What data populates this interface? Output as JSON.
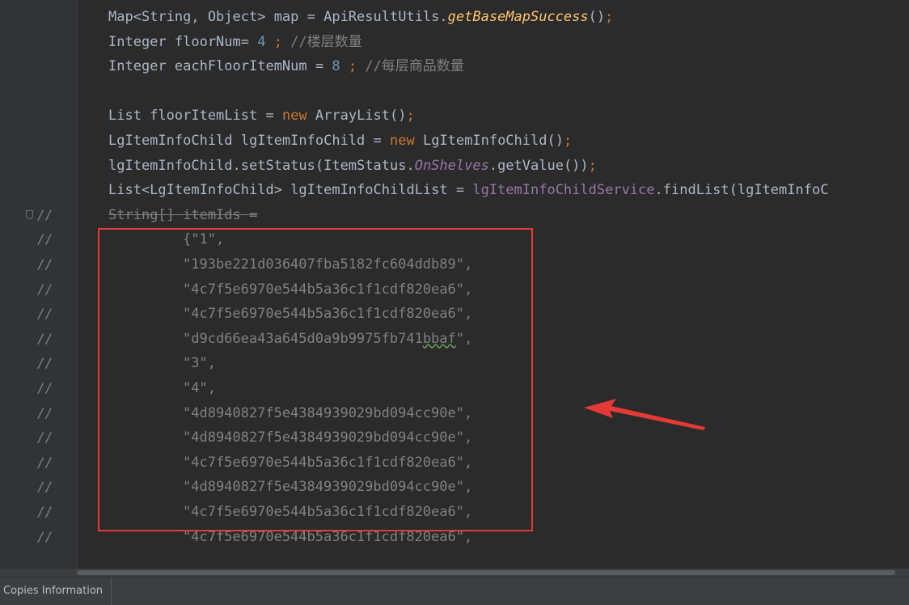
{
  "editor": {
    "lines": [
      {
        "gutter": "",
        "parts": [
          {
            "t": "Map<String, Object> map = ApiResultUtils.",
            "c": ""
          },
          {
            "t": "getBaseMapSuccess",
            "c": "it"
          },
          {
            "t": "()",
            "c": ""
          },
          {
            "t": ";",
            "c": "kw"
          }
        ]
      },
      {
        "gutter": "",
        "parts": [
          {
            "t": "Integer floorNum= ",
            "c": ""
          },
          {
            "t": "4",
            "c": "num"
          },
          {
            "t": " ; ",
            "c": "kw"
          },
          {
            "t": "//楼层数量",
            "c": "cm"
          }
        ]
      },
      {
        "gutter": "",
        "parts": [
          {
            "t": "Integer eachFloorItemNum = ",
            "c": ""
          },
          {
            "t": "8",
            "c": "num"
          },
          {
            "t": " ; ",
            "c": "kw"
          },
          {
            "t": "//每层商品数量",
            "c": "cm"
          }
        ]
      },
      {
        "gutter": "",
        "parts": []
      },
      {
        "gutter": "",
        "parts": [
          {
            "t": "List floorItemList = ",
            "c": ""
          },
          {
            "t": "new",
            "c": "kw"
          },
          {
            "t": " ArrayList()",
            "c": ""
          },
          {
            "t": ";",
            "c": "kw"
          }
        ]
      },
      {
        "gutter": "",
        "parts": [
          {
            "t": "LgItemInfoChild lgItemInfoChild = ",
            "c": ""
          },
          {
            "t": "new",
            "c": "kw"
          },
          {
            "t": " LgItemInfoChild()",
            "c": ""
          },
          {
            "t": ";",
            "c": "kw"
          }
        ]
      },
      {
        "gutter": "",
        "parts": [
          {
            "t": "lgItemInfoChild.setStatus(ItemStatus.",
            "c": ""
          },
          {
            "t": "OnShelves",
            "c": "fld"
          },
          {
            "t": ".getValue())",
            "c": ""
          },
          {
            "t": ";",
            "c": "kw"
          }
        ]
      },
      {
        "gutter": "",
        "parts": [
          {
            "t": "List<LgItemInfoChild> lgItemInfoChildList = ",
            "c": ""
          },
          {
            "t": "lgItemInfoChildService",
            "c": "fld2"
          },
          {
            "t": ".findList(lgItemInfoC",
            "c": ""
          }
        ]
      },
      {
        "gutter": "//",
        "fold": true,
        "parts": [
          {
            "t": "String[] itemIds =",
            "c": "cmt-text strike"
          }
        ]
      },
      {
        "gutter": "//",
        "indent": 2,
        "parts": [
          {
            "t": "{\"1\",",
            "c": "cmt-text"
          }
        ]
      },
      {
        "gutter": "//",
        "indent": 2,
        "parts": [
          {
            "t": "\"193be221d036407fba5182fc604ddb89\",",
            "c": "cmt-text"
          }
        ]
      },
      {
        "gutter": "//",
        "indent": 2,
        "parts": [
          {
            "t": "\"4c7f5e6970e544b5a36c1f1cdf820ea6\",",
            "c": "cmt-text"
          }
        ]
      },
      {
        "gutter": "//",
        "indent": 2,
        "parts": [
          {
            "t": "\"4c7f5e6970e544b5a36c1f1cdf820ea6\",",
            "c": "cmt-text"
          }
        ]
      },
      {
        "gutter": "//",
        "indent": 2,
        "parts": [
          {
            "t": "\"d9cd66ea43a645d0a9b9975fb741",
            "c": "cmt-text"
          },
          {
            "t": "bbaf",
            "c": "cmt-text squiggle"
          },
          {
            "t": "\",",
            "c": "cmt-text"
          }
        ]
      },
      {
        "gutter": "//",
        "indent": 2,
        "parts": [
          {
            "t": "\"3\",",
            "c": "cmt-text"
          }
        ]
      },
      {
        "gutter": "//",
        "indent": 2,
        "parts": [
          {
            "t": "\"4\",",
            "c": "cmt-text"
          }
        ]
      },
      {
        "gutter": "//",
        "indent": 2,
        "parts": [
          {
            "t": "\"4d8940827f5e4384939029bd094cc90e\",",
            "c": "cmt-text"
          }
        ]
      },
      {
        "gutter": "//",
        "indent": 2,
        "parts": [
          {
            "t": "\"4d8940827f5e4384939029bd094cc90e\",",
            "c": "cmt-text"
          }
        ]
      },
      {
        "gutter": "//",
        "indent": 2,
        "parts": [
          {
            "t": "\"4c7f5e6970e544b5a36c1f1cdf820ea6\",",
            "c": "cmt-text"
          }
        ]
      },
      {
        "gutter": "//",
        "indent": 2,
        "parts": [
          {
            "t": "\"4d8940827f5e4384939029bd094cc90e\",",
            "c": "cmt-text"
          }
        ]
      },
      {
        "gutter": "//",
        "indent": 2,
        "parts": [
          {
            "t": "\"4c7f5e6970e544b5a36c1f1cdf820ea6\",",
            "c": "cmt-text"
          }
        ]
      },
      {
        "gutter": "//",
        "indent": 2,
        "parts": [
          {
            "t": "\"4c7f5e6970e544b5a36c1f1cdf820ea6\",",
            "c": "cmt-text"
          }
        ]
      }
    ]
  },
  "annotation": {
    "box_color": "#e53935",
    "arrow_color": "#e53935"
  },
  "statusbar": {
    "tab_label": "Copies Information"
  },
  "colors": {
    "background": "#2b2b2b",
    "keyword": "#cc7832",
    "number": "#6897bb",
    "comment": "#808080",
    "method_italic": "#ffc66d",
    "field_italic": "#9876aa"
  }
}
